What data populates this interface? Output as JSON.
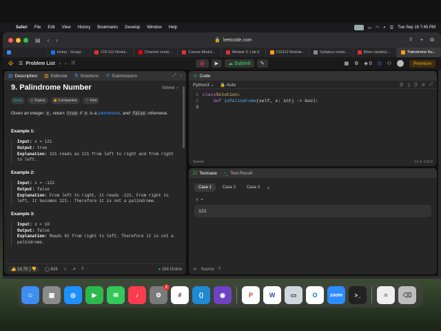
{
  "menubar": {
    "app": "Safari",
    "items": [
      "File",
      "Edit",
      "View",
      "History",
      "Bookmarks",
      "Develop",
      "Window",
      "Help"
    ],
    "clock": "Tue Sep 16  7:45 PM"
  },
  "browser": {
    "url": "leetcode.com",
    "tabs": [
      {
        "label": "",
        "color": "#4285f4"
      },
      {
        "label": "Home - Googl...",
        "color": "#1a73e8"
      },
      {
        "label": "CIS 112 Modul...",
        "color": "#d33"
      },
      {
        "label": "Channel conte...",
        "color": "#e00"
      },
      {
        "label": "Course Modul...",
        "color": "#d33"
      },
      {
        "label": "Module 3: Lab 2",
        "color": "#d33"
      },
      {
        "label": "CIS112 Module...",
        "color": "#f89f1b"
      },
      {
        "label": "Syllabus creati...",
        "color": "#888"
      },
      {
        "label": "[New Update]:...",
        "color": "#d33"
      },
      {
        "label": "Palindrome Nu...",
        "color": "#f89f1b"
      }
    ]
  },
  "lc_header": {
    "problem_list": "Problem List",
    "run": "▶",
    "submit": "Submit",
    "streak": "0",
    "premium": "Premium"
  },
  "left_tabs": [
    "Description",
    "Editorial",
    "Solutions",
    "Submissions"
  ],
  "problem": {
    "title": "9. Palindrome Number",
    "solved": "Solved",
    "tags": [
      "Easy",
      "Topics",
      "Companies",
      "Hint"
    ],
    "stmt_1": "Given an integer ",
    "stmt_x": "x",
    "stmt_2": ", return ",
    "stmt_true": "true",
    "stmt_3": " if ",
    "stmt_x2": "x",
    "stmt_4": " is a ",
    "stmt_link": "palindrome",
    "stmt_5": ", and ",
    "stmt_false": "false",
    "stmt_6": " otherwise.",
    "examples": [
      {
        "title": "Example 1:",
        "input": "x = 121",
        "output": "true",
        "explanation": "121 reads as 121 from left to right and from right to left."
      },
      {
        "title": "Example 2:",
        "input": "x = -121",
        "output": "false",
        "explanation": "From left to right, it reads -121. From right to left, it becomes 121-. Therefore it is not a palindrome."
      },
      {
        "title": "Example 3:",
        "input": "x = 10",
        "output": "false",
        "explanation": "Reads 01 from right to left. Therefore it is not a palindrome."
      }
    ],
    "labels": {
      "input": "Input:",
      "output": "Output:",
      "explanation": "Explanation:"
    },
    "likes": "14.7K",
    "comments": "616",
    "online": "268 Online"
  },
  "code": {
    "tab": "Code",
    "language": "Python3",
    "mode": "Auto",
    "lines": [
      {
        "n": "1",
        "parts": [
          [
            "kw",
            "class "
          ],
          [
            "ty",
            "Solution"
          ],
          [
            "plain",
            ":"
          ]
        ]
      },
      {
        "n": "2",
        "parts": [
          [
            "plain",
            "    "
          ],
          [
            "kw",
            "def "
          ],
          [
            "fn",
            "isPalindrome"
          ],
          [
            "plain",
            "(self, x: int) -> bool:"
          ]
        ]
      },
      {
        "n": "3",
        "parts": [
          [
            "plain",
            ""
          ]
        ]
      }
    ],
    "saved": "Saved",
    "position": "Ln 3, Col 9"
  },
  "test": {
    "tab1": "Testcase",
    "tab2": "Test Result",
    "cases": [
      "Case 1",
      "Case 2",
      "Case 3"
    ],
    "var_label": "x =",
    "var_value": "121",
    "source": "Source"
  },
  "dock": [
    {
      "name": "finder",
      "color": "#3d8ef0",
      "glyph": "☺"
    },
    {
      "name": "launchpad",
      "color": "#8a8a8a",
      "glyph": "▦"
    },
    {
      "name": "safari",
      "color": "#1e90ff",
      "glyph": "◎"
    },
    {
      "name": "facetime",
      "color": "#2db84d",
      "glyph": "▶"
    },
    {
      "name": "messages",
      "color": "#34c759",
      "glyph": "✉"
    },
    {
      "name": "music",
      "color": "#fa3c4c",
      "glyph": "♪"
    },
    {
      "name": "system-settings",
      "color": "#7a7a7a",
      "glyph": "⚙",
      "badge": "2"
    },
    {
      "name": "slack",
      "color": "#ffffff",
      "glyph": "#"
    },
    {
      "name": "vscode",
      "color": "#1f8ad2",
      "glyph": "⟨⟩"
    },
    {
      "name": "github",
      "color": "#6f42c1",
      "glyph": "◉"
    },
    {
      "name": "powerpoint",
      "color": "#ffffff",
      "glyph": "P"
    },
    {
      "name": "word",
      "color": "#ffffff",
      "glyph": "W"
    },
    {
      "name": "preview",
      "color": "#cfd8dc",
      "glyph": "▭"
    },
    {
      "name": "outlook",
      "color": "#ffffff",
      "glyph": "O"
    },
    {
      "name": "zoom",
      "color": "#2d8cff",
      "glyph": "zoom"
    },
    {
      "name": "terminal",
      "color": "#222222",
      "glyph": ">_"
    },
    {
      "name": "document",
      "color": "#eeeeee",
      "glyph": "≡"
    },
    {
      "name": "trash",
      "color": "#bdbdbd",
      "glyph": "🗑"
    }
  ]
}
